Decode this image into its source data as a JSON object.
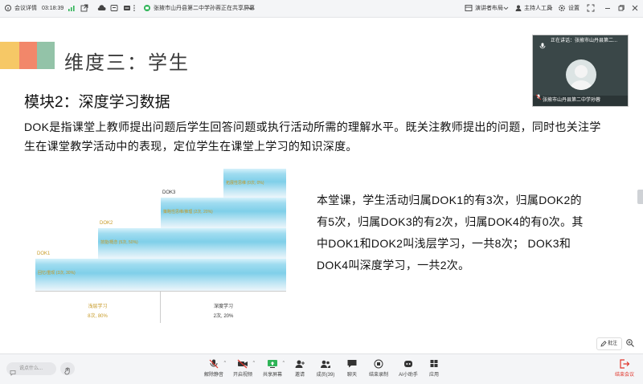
{
  "topbar": {
    "meeting_details": "会议详情",
    "timer": "03:18:39",
    "sharing_notice": "张掖市山丹县第二中学孙蓉正在共享屏幕",
    "presenter_layout": "演讲者布局",
    "host_tools": "主持人工具",
    "settings": "设置"
  },
  "slide": {
    "title": "维度三：学生",
    "module_title": "模块2：深度学习数据",
    "definition": "DOK是指课堂上教师提出问题后学生回答问题或执行活动所需的理解水平。既关注教师提出的问题，同时也关注学生在课堂教学活动中的表现，定位学生在课堂上学习的知识深度。",
    "summary": "本堂课，学生活动归属DOK1的有3次，归属DOK2的有5次，归属DOK3的有2次，归属DOK4的有0次。其中DOK1和DOK2叫浅层学习，一共8次； DOK3和DOK4叫深度学习，一共2次。",
    "deco_colors": [
      "#f6c866",
      "#f2876a",
      "#93c3a8"
    ],
    "pyramid": {
      "levels": [
        {
          "caption": "DOK1",
          "label": "回忆/重现 (3次, 30%)"
        },
        {
          "caption": "DOK2",
          "label": "技能/概念 (5次, 50%)"
        },
        {
          "caption": "DOK3",
          "label": "策略性思维/推理 (2次, 20%)"
        },
        {
          "caption": "",
          "label": "拓展性思维 (0次, 0%)"
        }
      ],
      "base": [
        {
          "label": "浅层学习",
          "value": "8次, 80%"
        },
        {
          "label": "深度学习",
          "value": "2次, 20%"
        }
      ]
    }
  },
  "video": {
    "speaking": "正在讲话：张掖市山丹县第二...",
    "name": "张掖市山丹县第二中学孙蓉"
  },
  "annotate": "批注",
  "bottombar": {
    "chat_placeholder": "说点什么...",
    "tools": [
      {
        "icon": "mic-off-icon",
        "label": "解除静音"
      },
      {
        "icon": "camera-off-icon",
        "label": "开启视频"
      },
      {
        "icon": "share-screen-icon",
        "label": "共享屏幕"
      },
      {
        "icon": "invite-icon",
        "label": "邀请"
      },
      {
        "icon": "members-icon",
        "label": "成员(39)"
      },
      {
        "icon": "chat-icon",
        "label": "聊天"
      },
      {
        "icon": "record-icon",
        "label": "结束录制"
      },
      {
        "icon": "ai-assistant-icon",
        "label": "AI小助手"
      },
      {
        "icon": "apps-icon",
        "label": "应用"
      }
    ],
    "leave": "结束会议"
  }
}
